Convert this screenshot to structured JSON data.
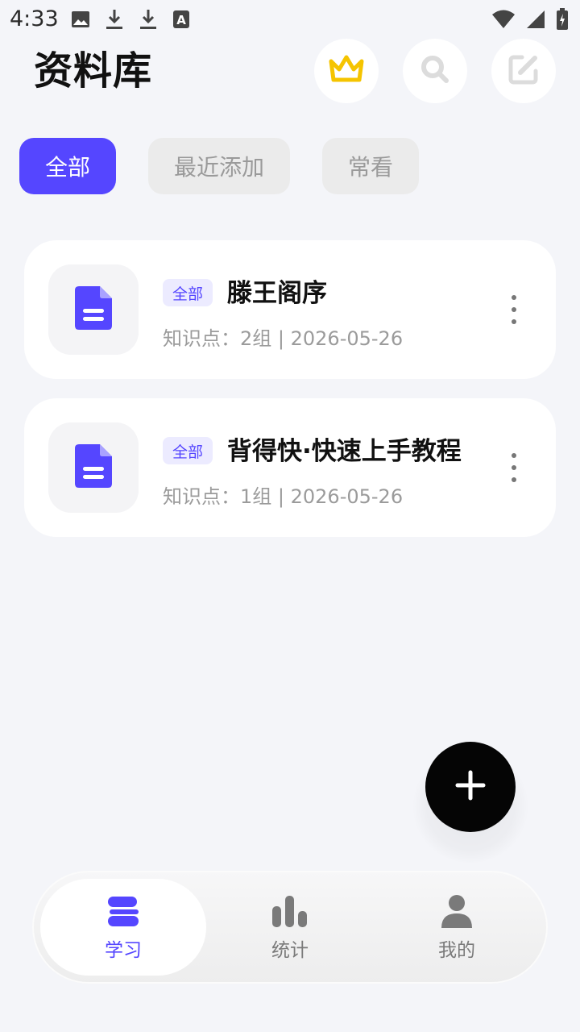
{
  "status_bar": {
    "time": "4:33",
    "left_icons": [
      "image-icon",
      "download-icon",
      "download-icon",
      "a-badge-icon"
    ],
    "right_icons": [
      "wifi-icon",
      "signal-icon",
      "battery-icon"
    ]
  },
  "header": {
    "title": "资料库",
    "actions": [
      "crown-icon",
      "search-icon",
      "edit-icon"
    ]
  },
  "filters": [
    {
      "label": "全部",
      "active": true
    },
    {
      "label": "最近添加",
      "active": false
    },
    {
      "label": "常看",
      "active": false
    }
  ],
  "documents": [
    {
      "tag": "全部",
      "title": "滕王阁序",
      "meta": "知识点：2组 | 2026-05-26"
    },
    {
      "tag": "全部",
      "title": "背得快·快速上手教程",
      "meta": "知识点：1组 | 2026-05-26"
    }
  ],
  "fab": {
    "icon": "plus-icon"
  },
  "tabbar": {
    "tabs": [
      {
        "label": "学习",
        "icon": "study-icon",
        "active": true
      },
      {
        "label": "统计",
        "icon": "bar-chart-icon",
        "active": false
      },
      {
        "label": "我的",
        "icon": "user-icon",
        "active": false
      }
    ]
  },
  "colors": {
    "accent": "#5546ff",
    "crown": "#f5c400",
    "background": "#f4f5f9",
    "fab": "#050505"
  }
}
